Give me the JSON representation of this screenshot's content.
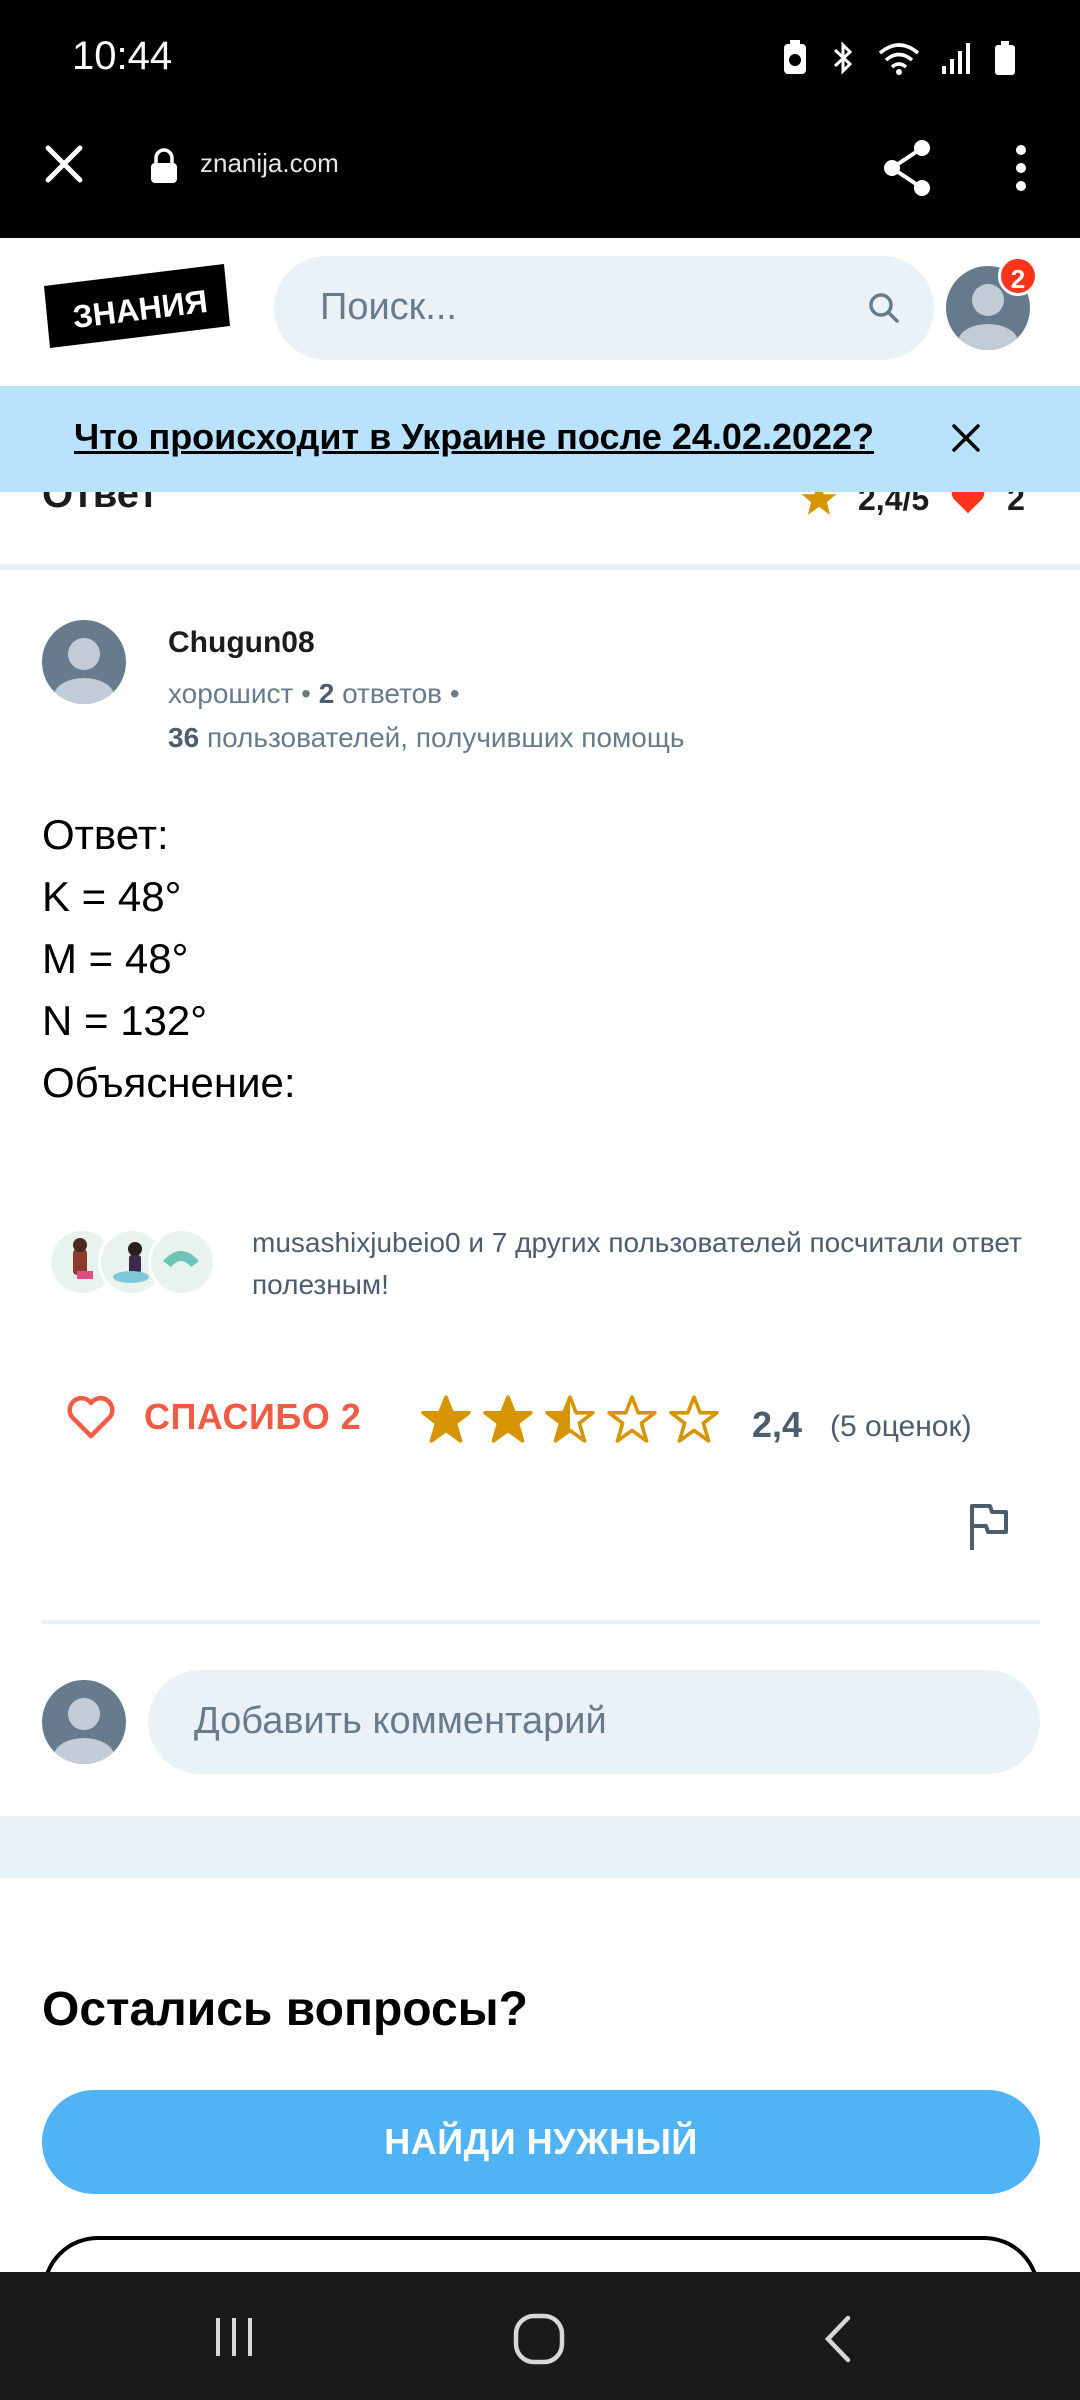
{
  "status_bar": {
    "time": "10:44"
  },
  "browser": {
    "url": "znanija.com"
  },
  "site": {
    "logo_text": "ЗНАНИЯ",
    "search_placeholder": "Поиск...",
    "notifications_count": "2"
  },
  "banner": {
    "text": "Что происходит в Украине после 24.02.2022?"
  },
  "answer_header": {
    "title": "Ответ",
    "rating": "2,4/5",
    "likes": "2"
  },
  "author": {
    "name": "Chugun08",
    "rank": "хорошист",
    "answers_count": "2",
    "answers_label": "ответов",
    "helped_count": "36",
    "helped_label": "пользователей, получивших помощь"
  },
  "answer": {
    "lines": [
      "Ответ:",
      "K = 48°",
      "M = 48°",
      "N = 132°",
      "Объяснение:"
    ]
  },
  "helpful": {
    "text": "musashixjubeio0 и 7 других пользователей посчитали ответ полезным!"
  },
  "thanks": {
    "label": "СПАСИБО 2"
  },
  "rating": {
    "value": "2,4",
    "count": "(5 оценок)",
    "stars": 2.4,
    "star_color": "#d59400"
  },
  "comment": {
    "placeholder": "Добавить комментарий"
  },
  "more_questions": {
    "title": "Остались вопросы?",
    "button": "НАЙДИ НУЖНЫЙ"
  },
  "colors": {
    "accent": "#4fb3f6",
    "thanks": "#ef5c46",
    "banner": "#b9e2fe",
    "badge": "#ff341a"
  }
}
